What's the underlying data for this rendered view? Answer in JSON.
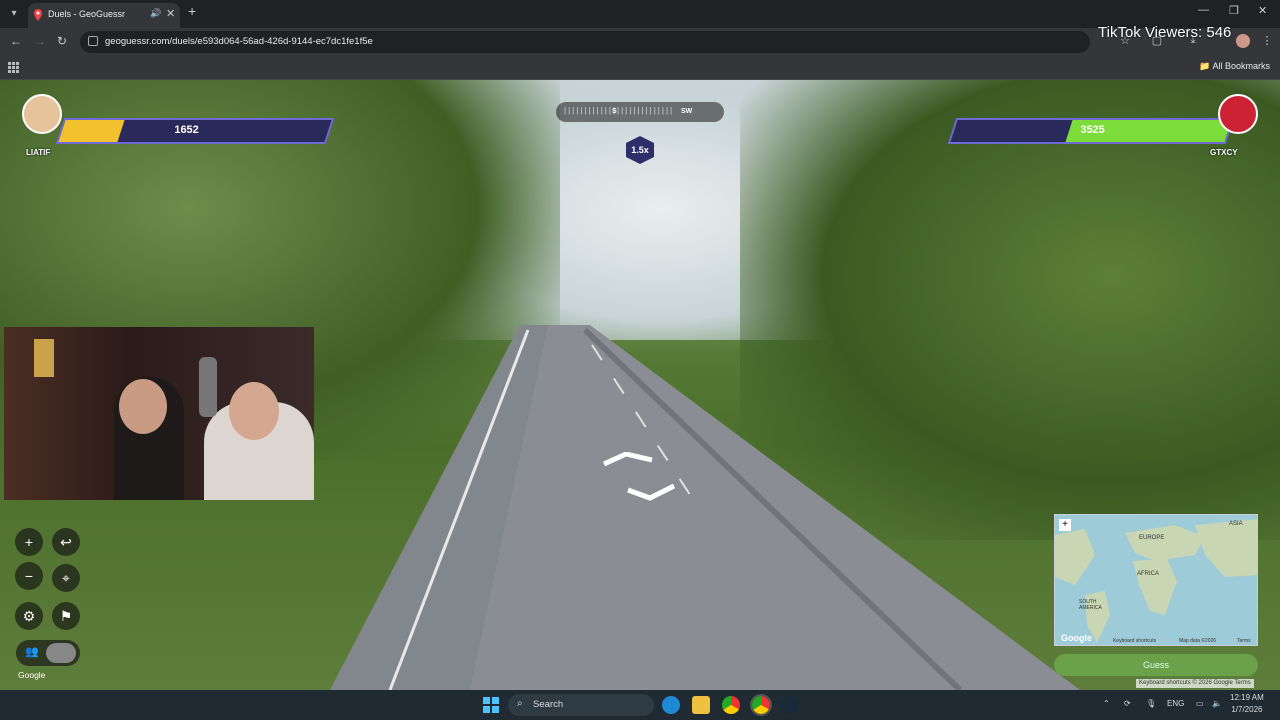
{
  "browser": {
    "tab_title": "Duels - GeoGuessr",
    "url": "geoguessr.com/duels/e593d064-56ad-426d-9144-ec7dc1fe1f5e",
    "all_bookmarks": "All Bookmarks"
  },
  "overlay": {
    "tiktok_viewers": "TikTok Viewers: 546"
  },
  "duel": {
    "player1": {
      "name": "LIATIF",
      "hp": "1652",
      "hp_fraction": 0.22
    },
    "player2": {
      "name": "GTXCY",
      "hp": "3525",
      "hp_fraction": 0.58
    }
  },
  "compass": {
    "labels": [
      "S",
      "SW"
    ]
  },
  "zoom": {
    "label": "1.5x"
  },
  "google_label": "Google",
  "minimap": {
    "labels": [
      "ASIA",
      "EUROPE",
      "AFRICA",
      "SOUTH AMERICA"
    ],
    "google": "Google",
    "footer": [
      "Keyboard shortcuts",
      "Map data ©2026",
      "Terms"
    ]
  },
  "guess_button": "Guess",
  "attribution": "Keyboard shortcuts   © 2026 Google   Terms",
  "taskbar": {
    "search": "Search",
    "lang": "ENG",
    "time": "12:19 AM",
    "date": "1/7/2026"
  },
  "colors": {
    "hp_p1": "#f2c12e",
    "hp_p2": "#7bdc3a",
    "hp_bg": "#2a2a5a",
    "hp_border": "#6f6ad6"
  }
}
